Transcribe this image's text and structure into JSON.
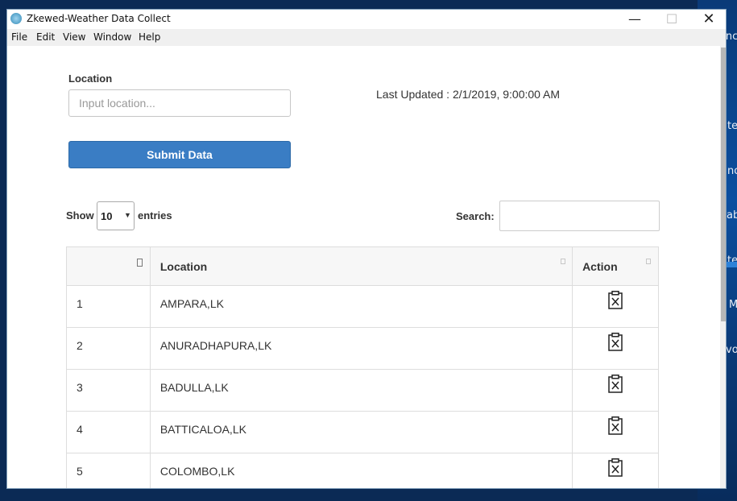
{
  "desktop": {
    "text_lines": [
      "Instanc",
      "c",
      "te",
      "no",
      "ab",
      "te",
      "M",
      "vo"
    ]
  },
  "window": {
    "title": "Zkewed-Weather Data Collect",
    "minimize_symbol": "—",
    "maximize_symbol": "☐",
    "close_symbol": "✕"
  },
  "menu": {
    "items": [
      "File",
      "Edit",
      "View",
      "Window",
      "Help"
    ]
  },
  "form": {
    "location_label": "Location",
    "location_placeholder": "Input location...",
    "location_value": "",
    "last_updated": "Last Updated : 2/1/2019, 9:00:00 AM",
    "submit_label": "Submit Data"
  },
  "table_controls": {
    "show_label": "Show",
    "entries_value": "10",
    "entries_label": "entries",
    "search_label": "Search:",
    "search_value": ""
  },
  "table": {
    "headers": [
      "",
      "Location",
      "Action"
    ],
    "rows": [
      {
        "num": "1",
        "location": "AMPARA,LK"
      },
      {
        "num": "2",
        "location": "ANURADHAPURA,LK"
      },
      {
        "num": "3",
        "location": "BADULLA,LK"
      },
      {
        "num": "4",
        "location": "BATTICALOA,LK"
      },
      {
        "num": "5",
        "location": "COLOMBO,LK"
      }
    ],
    "action_icon": "delete-clipboard-icon"
  },
  "colors": {
    "primary_button": "#3a7dc4",
    "desktop_bg": "#0b2a55"
  }
}
